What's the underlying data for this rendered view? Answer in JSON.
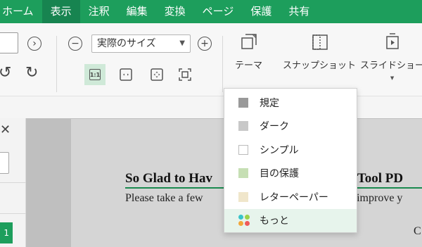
{
  "menubar": {
    "items": [
      "ホーム",
      "表示",
      "注釈",
      "編集",
      "変換",
      "ページ",
      "保護",
      "共有"
    ],
    "active_index": 1
  },
  "ribbon": {
    "zoom": {
      "value": "実際のサイズ"
    },
    "fit_actual_label": "1:1",
    "tools": [
      {
        "label": "テーマ"
      },
      {
        "label": "スナップショット"
      },
      {
        "label": "スライドショー"
      }
    ]
  },
  "theme_menu": {
    "items": [
      {
        "label": "規定",
        "color": "#999999"
      },
      {
        "label": "ダーク",
        "color": "#c8c8c8"
      },
      {
        "label": "シンプル",
        "color": "#ffffff"
      },
      {
        "label": "目の保護",
        "color": "#c6dfb4"
      },
      {
        "label": "レターペーパー",
        "color": "#f0e6cb"
      },
      {
        "label": "もっと",
        "colors": [
          "#39c4c9",
          "#f2a83a",
          "#ef5b5b",
          "#9bd24a"
        ]
      }
    ]
  },
  "document": {
    "title_left": "So Glad to Hav",
    "title_right": "niTool PD",
    "body_left": "Please take a few",
    "body_right": "ve improve y",
    "corner_text": "C"
  },
  "sidebar": {
    "page_number": "1"
  }
}
